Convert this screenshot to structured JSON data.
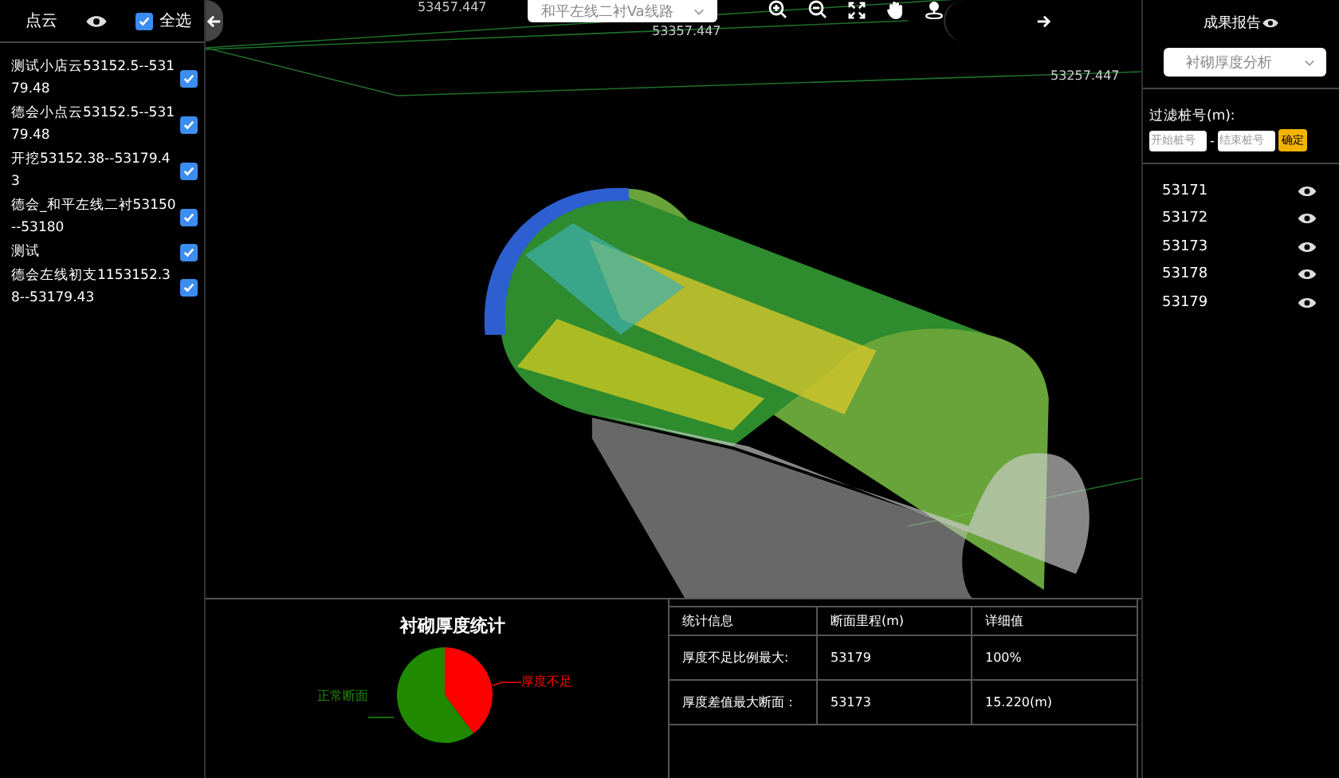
{
  "left_panel": {
    "title": "点云",
    "select_all": {
      "label": "全选",
      "checked": true
    },
    "items": [
      {
        "label": "测试小店云53152.5--53179.48",
        "checked": true
      },
      {
        "label": "德会小点云53152.5--53179.48",
        "checked": true
      },
      {
        "label": "开挖53152.38--53179.43",
        "checked": true
      },
      {
        "label": "德会_和平左线二衬53150--53180",
        "checked": true
      },
      {
        "label": "测试",
        "checked": true
      },
      {
        "label": "德会左线初支1153152.38--53179.43",
        "checked": true
      }
    ]
  },
  "viewport": {
    "route_select": {
      "value": "和平左线二衬Va线路"
    },
    "mileage_labels": [
      "53457.447",
      "53357.447",
      "53257.447"
    ]
  },
  "bottom_panel": {
    "chart_title": "衬砌厚度统计",
    "pie_labels": [
      {
        "text": "厚度不足",
        "color": "#ff0000"
      },
      {
        "text": "正常断面",
        "color": "#1f8a00"
      }
    ],
    "table": {
      "columns": [
        "统计信息",
        "断面里程(m)",
        "详细值"
      ],
      "rows": [
        [
          "厚度不足比例最大:",
          "53179",
          "100%"
        ],
        [
          "厚度差值最大断面：",
          "53173",
          "15.220(m)"
        ]
      ]
    }
  },
  "right_panel": {
    "title": "成果报告",
    "analysis_select": {
      "value": "衬砌厚度分析"
    },
    "filter": {
      "label": "过滤桩号(m):",
      "start_placeholder": "开始桩号",
      "separator": "-",
      "end_placeholder": "结束桩号",
      "button": "确定"
    },
    "sections": [
      "53171",
      "53172",
      "53173",
      "53178",
      "53179"
    ]
  }
}
